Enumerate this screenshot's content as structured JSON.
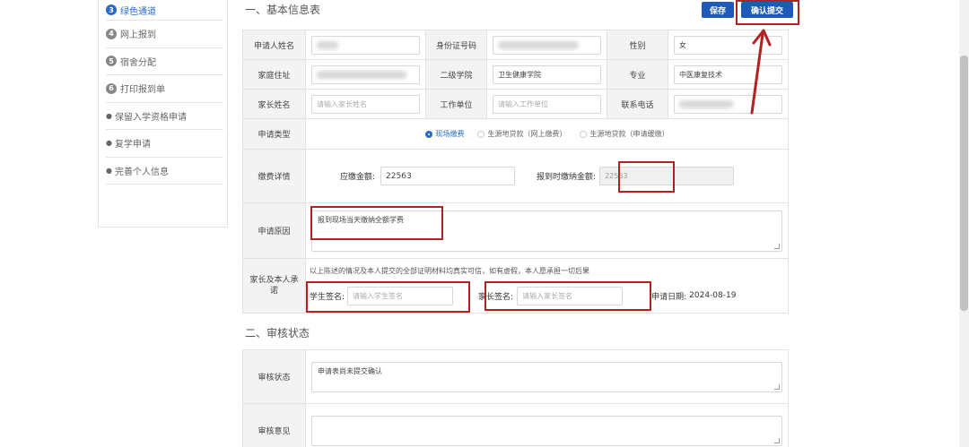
{
  "sidebar": {
    "items": [
      {
        "num": "3",
        "label": "绿色通道",
        "active": true
      },
      {
        "num": "4",
        "label": "网上报到"
      },
      {
        "num": "5",
        "label": "宿舍分配"
      },
      {
        "num": "6",
        "label": "打印报到单"
      },
      {
        "dot": "●",
        "label": "保留入学资格申请"
      },
      {
        "dot": "●",
        "label": "复学申请"
      },
      {
        "dot": "●",
        "label": "完善个人信息"
      }
    ]
  },
  "section1": {
    "title": "一、基本信息表"
  },
  "actions": {
    "save_label": "保存",
    "submit_label": "确认提交"
  },
  "form": {
    "applicant_name_label": "申请人姓名",
    "id_number_label": "身份证号码",
    "gender_label": "性别",
    "gender_value": "女",
    "address_label": "家庭住址",
    "college_label": "二级学院",
    "college_value": "卫生健康学院",
    "major_label": "专业",
    "major_value": "中医康复技术",
    "parent_name_label": "家长姓名",
    "parent_name_placeholder": "请输入家长姓名",
    "work_unit_label": "工作单位",
    "work_unit_placeholder": "请输入工作单位",
    "phone_label": "联系电话",
    "apply_type_label": "申请类型",
    "apply_types": [
      "现场缴费",
      "生源地贷款（网上缴费）",
      "生源地贷款（申请缓缴）"
    ],
    "payment_label": "缴费详情",
    "due_label": "应缴金额:",
    "due_value": "22563",
    "pay_on_report_label": "报到时缴纳金额:",
    "pay_on_report_value": "22563",
    "reason_label": "申请原因",
    "reason_value": "报到现场当天缴纳全额学费",
    "pledge_label": "家长及本人承诺",
    "pledge_text": "以上陈述的情况及本人提交的全部证明材料均真实可信，如有虚假，本人愿承担一切后果",
    "student_sign_label": "学生签名:",
    "student_sign_placeholder": "请输入学生签名",
    "parent_sign_label": "家长签名:",
    "parent_sign_placeholder": "请输入家长签名",
    "apply_date_label": "申请日期:",
    "apply_date_value": "2024-08-19"
  },
  "section2": {
    "title": "二、审核状态"
  },
  "audit": {
    "status_label": "审核状态",
    "status_value": "申请表尚未提交确认",
    "opinion_label": "审核意见"
  },
  "colors": {
    "accent": "#1e5bb8",
    "annotation": "#b32222"
  }
}
